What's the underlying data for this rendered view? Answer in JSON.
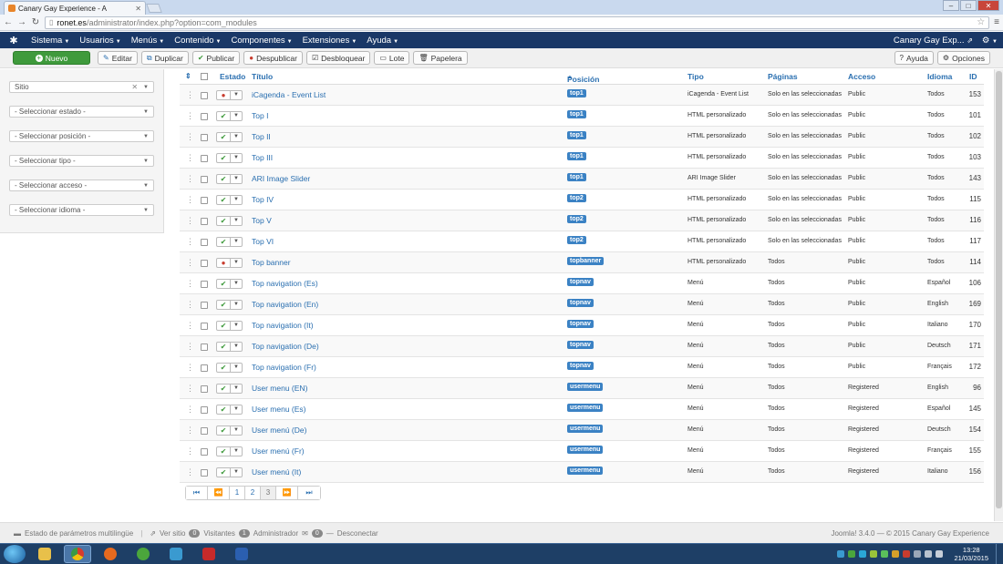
{
  "browser": {
    "tab_title": "Canary Gay Experience - A",
    "url_host": "ronet.es",
    "url_path": "/administrator/index.php?option=com_modules"
  },
  "navbar": {
    "menus": [
      "Sistema",
      "Usuarios",
      "Menús",
      "Contenido",
      "Componentes",
      "Extensiones",
      "Ayuda"
    ],
    "site_name": "Canary Gay Exp..."
  },
  "toolbar": {
    "new": "Nuevo",
    "edit": "Editar",
    "duplicate": "Duplicar",
    "publish": "Publicar",
    "unpublish": "Despublicar",
    "unlock": "Desbloquear",
    "batch": "Lote",
    "trash": "Papelera",
    "help": "Ayuda",
    "options": "Opciones"
  },
  "filters": {
    "client": "Sitio",
    "state": "- Seleccionar estado -",
    "position": "- Seleccionar posición -",
    "type": "- Seleccionar tipo -",
    "access": "- Seleccionar acceso -",
    "language": "- Seleccionar idioma -"
  },
  "table": {
    "headers": {
      "status": "Estado",
      "title": "Título",
      "position": "Posición",
      "type": "Tipo",
      "pages": "Páginas",
      "access": "Acceso",
      "language": "Idioma",
      "id": "ID"
    },
    "rows": [
      {
        "published": false,
        "title": "iCagenda - Event List",
        "position": "top1",
        "type": "iCagenda - Event List",
        "pages": "Solo en las seleccionadas",
        "access": "Public",
        "language": "Todos",
        "id": "153"
      },
      {
        "published": true,
        "title": "Top I",
        "position": "top1",
        "type": "HTML personalizado",
        "pages": "Solo en las seleccionadas",
        "access": "Public",
        "language": "Todos",
        "id": "101"
      },
      {
        "published": true,
        "title": "Top II",
        "position": "top1",
        "type": "HTML personalizado",
        "pages": "Solo en las seleccionadas",
        "access": "Public",
        "language": "Todos",
        "id": "102"
      },
      {
        "published": true,
        "title": "Top III",
        "position": "top1",
        "type": "HTML personalizado",
        "pages": "Solo en las seleccionadas",
        "access": "Public",
        "language": "Todos",
        "id": "103"
      },
      {
        "published": true,
        "title": "ARI Image Slider",
        "position": "top1",
        "type": "ARI Image Slider",
        "pages": "Solo en las seleccionadas",
        "access": "Public",
        "language": "Todos",
        "id": "143"
      },
      {
        "published": true,
        "title": "Top IV",
        "position": "top2",
        "type": "HTML personalizado",
        "pages": "Solo en las seleccionadas",
        "access": "Public",
        "language": "Todos",
        "id": "115"
      },
      {
        "published": true,
        "title": "Top V",
        "position": "top2",
        "type": "HTML personalizado",
        "pages": "Solo en las seleccionadas",
        "access": "Public",
        "language": "Todos",
        "id": "116"
      },
      {
        "published": true,
        "title": "Top VI",
        "position": "top2",
        "type": "HTML personalizado",
        "pages": "Solo en las seleccionadas",
        "access": "Public",
        "language": "Todos",
        "id": "117"
      },
      {
        "published": false,
        "title": "Top banner",
        "position": "topbanner",
        "type": "HTML personalizado",
        "pages": "Todos",
        "access": "Public",
        "language": "Todos",
        "id": "114"
      },
      {
        "published": true,
        "title": "Top navigation (Es)",
        "position": "topnav",
        "type": "Menú",
        "pages": "Todos",
        "access": "Public",
        "language": "Español",
        "id": "106"
      },
      {
        "published": true,
        "title": "Top navigation (En)",
        "position": "topnav",
        "type": "Menú",
        "pages": "Todos",
        "access": "Public",
        "language": "English",
        "id": "169"
      },
      {
        "published": true,
        "title": "Top navigation (It)",
        "position": "topnav",
        "type": "Menú",
        "pages": "Todos",
        "access": "Public",
        "language": "Italiano",
        "id": "170"
      },
      {
        "published": true,
        "title": "Top navigation (De)",
        "position": "topnav",
        "type": "Menú",
        "pages": "Todos",
        "access": "Public",
        "language": "Deutsch",
        "id": "171"
      },
      {
        "published": true,
        "title": "Top navigation (Fr)",
        "position": "topnav",
        "type": "Menú",
        "pages": "Todos",
        "access": "Public",
        "language": "Français",
        "id": "172"
      },
      {
        "published": true,
        "title": "User menu (EN)",
        "position": "usermenu",
        "type": "Menú",
        "pages": "Todos",
        "access": "Registered",
        "language": "English",
        "id": "96"
      },
      {
        "published": true,
        "title": "User menu (Es)",
        "position": "usermenu",
        "type": "Menú",
        "pages": "Todos",
        "access": "Registered",
        "language": "Español",
        "id": "145"
      },
      {
        "published": true,
        "title": "User menú (De)",
        "position": "usermenu",
        "type": "Menú",
        "pages": "Todos",
        "access": "Registered",
        "language": "Deutsch",
        "id": "154"
      },
      {
        "published": true,
        "title": "User menú (Fr)",
        "position": "usermenu",
        "type": "Menú",
        "pages": "Todos",
        "access": "Registered",
        "language": "Français",
        "id": "155"
      },
      {
        "published": true,
        "title": "User menú (It)",
        "position": "usermenu",
        "type": "Menú",
        "pages": "Todos",
        "access": "Registered",
        "language": "Italiano",
        "id": "156"
      }
    ]
  },
  "pagination": {
    "pages": [
      "1",
      "2",
      "3"
    ],
    "active": "3"
  },
  "statusbar": {
    "multilang": "Estado de parámetros multilingüe",
    "view_site": "Ver sitio",
    "visitors_count": "0",
    "visitors": "Visitantes",
    "admin_count": "1",
    "admin": "Administrador",
    "logout_count": "0",
    "logout": "Desconectar",
    "version": "Joomla! 3.4.0 — © 2015 Canary Gay Experience"
  },
  "taskbar": {
    "time": "13:28",
    "date": "21/03/2015"
  },
  "colors": {
    "navbar": "#1a3867",
    "new_button": "#3f9a3c",
    "position_badge": "#3b82c4",
    "link": "#2a6fb0"
  }
}
